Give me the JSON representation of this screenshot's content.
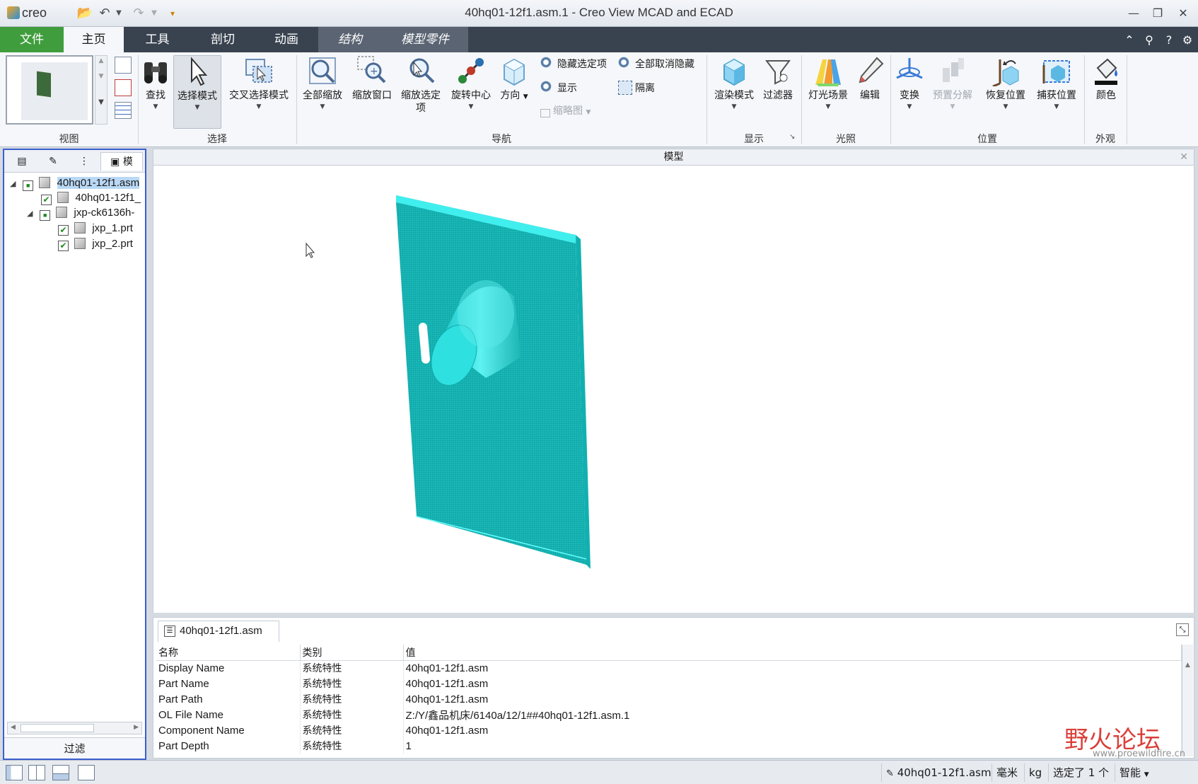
{
  "app": {
    "logo": "creo",
    "window_title": "40hq01-12f1.asm.1 - Creo View MCAD and ECAD"
  },
  "ribbon_tabs": [
    "文件",
    "主页",
    "工具",
    "剖切",
    "动画",
    "结构",
    "模型零件"
  ],
  "ribbon": {
    "view_group_label": "视图",
    "select_group": {
      "label": "选择",
      "find": "查找",
      "select_mode": "选择模式",
      "cross_select_mode": "交叉选择模式"
    },
    "nav_group": {
      "label": "导航",
      "zoom_all": "全部缩放",
      "zoom_window": "缩放窗口",
      "zoom_selected": "缩放选定项",
      "spin_center": "旋转中心",
      "orientation": "方向",
      "hide_selected": "隐藏选定项",
      "unhide_all": "全部取消隐藏",
      "show": "显示",
      "isolate": "隔离",
      "thumbnail": "缩略图"
    },
    "display_group": {
      "label": "显示",
      "render_mode": "渲染模式",
      "filter": "过滤器"
    },
    "lighting_group": {
      "label": "光照",
      "light_scene": "灯光场景",
      "edit": "编辑"
    },
    "position_group": {
      "label": "位置",
      "transform": "变换",
      "preset_explode": "预置分解",
      "restore_position": "恢复位置",
      "capture_position": "捕获位置"
    },
    "appearance_group": {
      "label": "外观",
      "color": "颜色"
    }
  },
  "left_panel": {
    "tab4_label": "模",
    "tree": [
      {
        "label": "40hq01-12f1.asm",
        "level": 0,
        "expanded": true,
        "selected": true
      },
      {
        "label": "40hq01-12f1_",
        "level": 1,
        "checked": true
      },
      {
        "label": "jxp-ck6136h-",
        "level": 1,
        "expanded": true
      },
      {
        "label": "jxp_1.prt",
        "level": 2,
        "checked": true
      },
      {
        "label": "jxp_2.prt",
        "level": 2,
        "checked": true
      }
    ],
    "filter_label": "过滤"
  },
  "viewport": {
    "header": "模型",
    "model_color": "#2fd9d9"
  },
  "properties": {
    "tab_label": "40hq01-12f1.asm",
    "columns": [
      "名称",
      "类别",
      "值"
    ],
    "rows": [
      [
        "Display Name",
        "系统特性",
        "40hq01-12f1.asm"
      ],
      [
        "Part Name",
        "系统特性",
        "40hq01-12f1.asm"
      ],
      [
        "Part Path",
        "系统特性",
        "40hq01-12f1.asm"
      ],
      [
        "OL File Name",
        "系统特性",
        "Z:/Y/鑫品机床/6140a/12/1##40hq01-12f1.asm.1"
      ],
      [
        "Component Name",
        "系统特性",
        "40hq01-12f1.asm"
      ],
      [
        "Part Depth",
        "系统特性",
        "1"
      ]
    ]
  },
  "status_bar": {
    "model": "40hq01-12f1.asm",
    "unit_length": "毫米",
    "unit_mass": "kg",
    "selected": "选定了 1 个",
    "mode": "智能"
  },
  "watermark": {
    "text": "野火论坛",
    "url": "www.proewildfire.cn"
  },
  "colors": {
    "file_tab": "#3f9d3d",
    "tab_bar": "#394350",
    "selection_border": "#3a5fcd"
  }
}
